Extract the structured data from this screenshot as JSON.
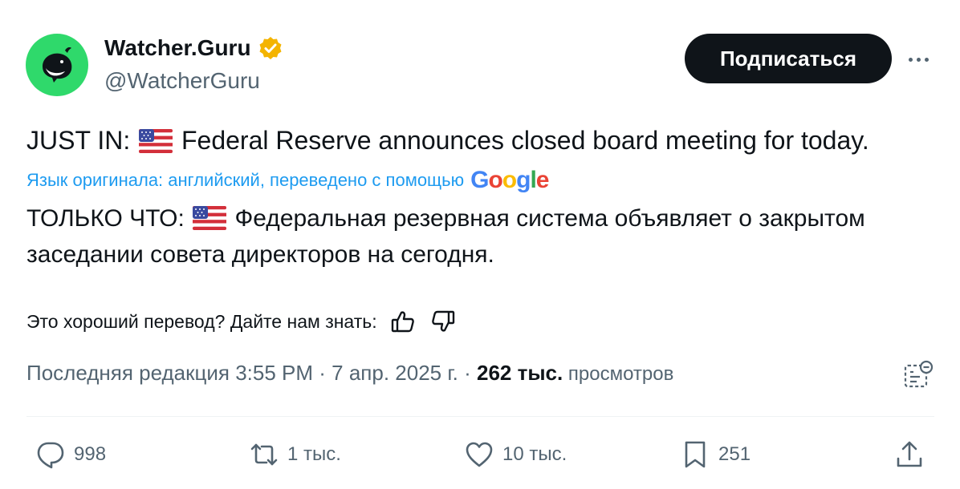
{
  "author": {
    "name": "Watcher.Guru",
    "handle": "@WatcherGuru",
    "avatar_color": "#2fd96b",
    "verified_badge_color": "#f4b400"
  },
  "subscribe_label": "Подписаться",
  "tweet": {
    "prefix": "JUST IN: ",
    "body": " Federal Reserve announces closed board meeting for today."
  },
  "translation": {
    "note": "Язык оригинала: английский, переведено с помощью",
    "provider": "Google",
    "prefix": "ТОЛЬКО ЧТО: ",
    "body": " Федеральная резервная система объявляет о закрытом заседании совета директоров на сегодня."
  },
  "feedback": {
    "question": "Это хороший перевод? Дайте нам знать:"
  },
  "meta": {
    "edited_prefix": "Последняя редакция ",
    "time": "3:55 PM",
    "separator": " · ",
    "date": "7 апр. 2025 г.",
    "views_count": "262 тыс.",
    "views_label": " просмотров"
  },
  "actions": {
    "replies": "998",
    "reposts": "1 тыс.",
    "likes": "10 тыс.",
    "bookmarks": "251"
  },
  "icons": {
    "reply": "reply-bubble-icon",
    "repost": "repost-arrows-icon",
    "like": "heart-icon",
    "bookmark": "bookmark-icon",
    "share": "share-upload-icon",
    "analytics": "analytics-icon",
    "thumbs_up": "thumbs-up-icon",
    "thumbs_down": "thumbs-down-icon",
    "flag": "us-flag-icon"
  },
  "colors": {
    "text_primary": "#0f1419",
    "text_secondary": "#536471",
    "link_blue": "#1d9bf0",
    "button_dark": "#0f1419"
  }
}
